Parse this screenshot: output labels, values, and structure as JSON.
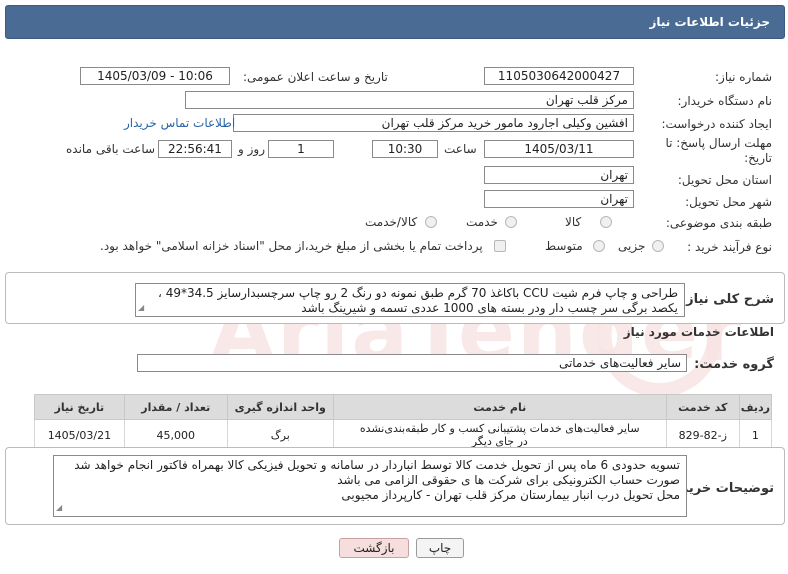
{
  "header": {
    "title": "جزئیات اطلاعات نیاز"
  },
  "fields": {
    "need_number_label": "شماره نیاز:",
    "need_number": "1105030642000427",
    "announce_label": "تاریخ و ساعت اعلان عمومی:",
    "announce_value": "1405/03/09 - 10:06",
    "buyer_org_label": "نام دستگاه خریدار:",
    "buyer_org": "مرکز قلب تهران",
    "creator_label": "ایجاد کننده درخواست:",
    "creator": "افشین وکیلی اجارود مامور خرید مرکز قلب تهران",
    "contact_link": "اطلاعات تماس خریدار",
    "deadline_label_1": "مهلت ارسال پاسخ: تا",
    "deadline_label_2": "تاریخ:",
    "deadline_date": "1405/03/11",
    "time_label": "ساعت",
    "deadline_time": "10:30",
    "days_value": "1",
    "days_label": "روز و",
    "remaining_time": "22:56:41",
    "remaining_label": "ساعت باقی مانده",
    "province_label": "استان محل تحویل:",
    "province": "تهران",
    "city_label": "شهر محل تحویل:",
    "city": "تهران",
    "category_label": "طبقه بندی موضوعی:",
    "category_options": [
      "کالا",
      "خدمت",
      "کالا/خدمت"
    ],
    "process_label": "نوع فرآیند خرید :",
    "process_options": [
      "جزیی",
      "متوسط"
    ],
    "payment_note": "پرداخت تمام یا بخشی از مبلغ خرید،از محل \"اسناد خزانه اسلامی\" خواهد بود."
  },
  "description": {
    "label": "شرح کلی نیاز:",
    "line1": "طراحی و چاپ فرم شیت CCU باکاغذ 70 گرم طبق نمونه دو رنگ 2 رو چاپ سرچسبدارسایز 34.5*49 ،",
    "line2": "یکصد برگی سر چسب دار ودر بسته های 1000 عددی تسمه و شیرینگ باشد"
  },
  "services": {
    "section_title": "اطلاعات خدمات مورد نیاز",
    "group_label": "گروه خدمت:",
    "group_value": "سایر فعالیت‌های خدماتی",
    "columns": [
      "ردیف",
      "کد خدمت",
      "نام خدمت",
      "واحد اندازه گیری",
      "تعداد / مقدار",
      "تاریخ نیاز"
    ],
    "rows": [
      {
        "row": "1",
        "code": "ز-82-829",
        "name_line1": "سایر فعالیت‌های خدمات پشتیبانی کسب و کار طبقه‌بندی‌نشده",
        "name_line2": "در جای دیگر",
        "unit": "برگ",
        "qty": "45,000",
        "date": "1405/03/21"
      }
    ]
  },
  "buyer_notes": {
    "label": "توضیحات خریدار:",
    "line1": "تسویه حدودی 6 ماه پس از تحویل خدمت کالا توسط انباردار در سامانه و تحویل فیزیکی کالا بهمراه فاکتور انجام خواهد شد",
    "line2": "صورت حساب الکترونیکی برای شرکت ها ی حقوقی الزامی می باشد",
    "line3": "محل تحویل درب انبار بیمارستان مرکز قلب تهران - کارپرداز مجیوبی"
  },
  "buttons": {
    "print": "چاپ",
    "back": "بازگشت"
  },
  "colors": {
    "header_bg": "#4a6b93",
    "link": "#2a64a8",
    "back_button_bg": "#f7dede"
  }
}
